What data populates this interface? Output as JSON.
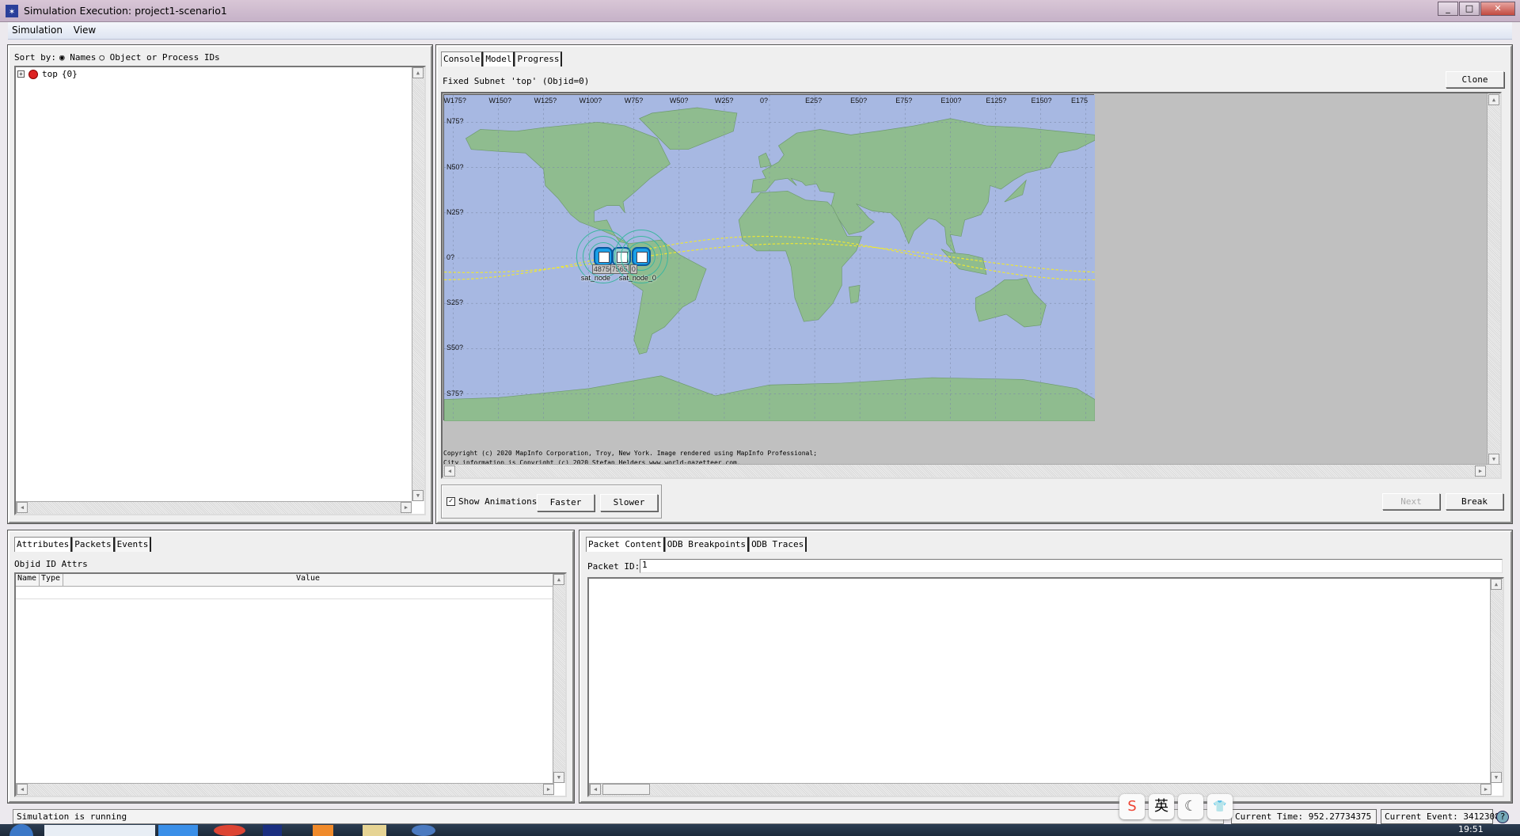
{
  "window": {
    "title": "Simulation Execution: project1-scenario1",
    "minimize": "_",
    "maximize": "□",
    "close": "✕"
  },
  "menu": {
    "items": [
      "Simulation",
      "View"
    ]
  },
  "tree_panel": {
    "sort_label": "Sort by:",
    "sort_options": [
      {
        "label": "Names",
        "selected": true
      },
      {
        "label": "Object or Process IDs",
        "selected": false
      }
    ],
    "root": {
      "expander": "+",
      "name": "top",
      "id": "{0}"
    }
  },
  "model_panel": {
    "tabs": [
      {
        "label": "Console",
        "active": false
      },
      {
        "label": "Model",
        "active": true
      },
      {
        "label": "Progress",
        "active": false
      }
    ],
    "subnet_label": "Fixed Subnet 'top' (Objid=0)",
    "clone_label": "Clone",
    "map": {
      "lon_labels": [
        "W175?",
        "W150?",
        "W125?",
        "W100?",
        "W75?",
        "W50?",
        "W25?",
        "0?",
        "E25?",
        "E50?",
        "E75?",
        "E100?",
        "E125?",
        "E150?",
        "E175"
      ],
      "lat_labels": [
        "N75?",
        "N50?",
        "N25?",
        "0?",
        "S25?",
        "S50?",
        "S75?"
      ],
      "ocean_color": "#a7b8e2",
      "land_color": "#8fbc8f",
      "orbit_color": "#f0e830",
      "nodes": [
        {
          "name": "sat_node",
          "counter": "487567"
        },
        {
          "name": "",
          "counter": "7565"
        },
        {
          "name": "sat_node_0",
          "counter": "0"
        }
      ]
    },
    "copyright": [
      "Copyright (c) 2020 MapInfo Corporation, Troy, New York. Image rendered using MapInfo Professional;",
      "City information is Copyright (c) 2020 Stefan Helders www.world-gazetteer.com."
    ],
    "show_animations_label": "Show Animations",
    "show_animations_checked": true,
    "faster_label": "Faster",
    "slower_label": "Slower",
    "next_label": "Next",
    "break_label": "Break"
  },
  "attributes_panel": {
    "tabs": [
      {
        "label": "Attributes",
        "active": true
      },
      {
        "label": "Packets",
        "active": false
      },
      {
        "label": "Events",
        "active": false
      }
    ],
    "caption": "Objid ID Attrs",
    "columns": [
      "Name",
      "Type",
      "Value"
    ]
  },
  "packet_panel": {
    "tabs": [
      {
        "label": "Packet Content",
        "active": true
      },
      {
        "label": "ODB Breakpoints",
        "active": false
      },
      {
        "label": "ODB Traces",
        "active": false
      }
    ],
    "packet_id_label": "Packet ID:",
    "packet_id_value": "1"
  },
  "status": {
    "message": "Simulation is running",
    "current_time": "Current Time: 952.27734375",
    "current_event": "Current Event: 3412308",
    "help": "?"
  },
  "ime_toolbar": [
    "S",
    "英",
    "☾",
    "👕"
  ],
  "taskbar": {
    "clock": "19:51"
  }
}
